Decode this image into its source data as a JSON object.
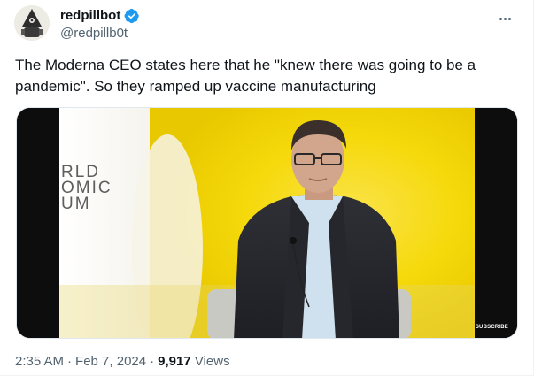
{
  "author": {
    "display_name": "redpillbot",
    "handle": "@redpillb0t",
    "verified": true,
    "avatar_icon": "pill-avatar-icon"
  },
  "tweet": {
    "text": "The Moderna CEO states here that he \"knew there was going to be a pandemic\". So they ramped up vaccine manufacturing"
  },
  "media": {
    "backdrop_text": [
      "RLD",
      "OMIC",
      "UM"
    ],
    "subscribe_label": "SUBSCRIBE"
  },
  "meta": {
    "time": "2:35 AM",
    "separator_1": "·",
    "date": "Feb 7, 2024",
    "separator_2": "·",
    "views_count": "9,917",
    "views_label": "Views"
  },
  "colors": {
    "accent_blue": "#1d9bf0",
    "text_primary": "#0f1419",
    "text_secondary": "#536471",
    "video_yellow": "#f5d90a"
  }
}
